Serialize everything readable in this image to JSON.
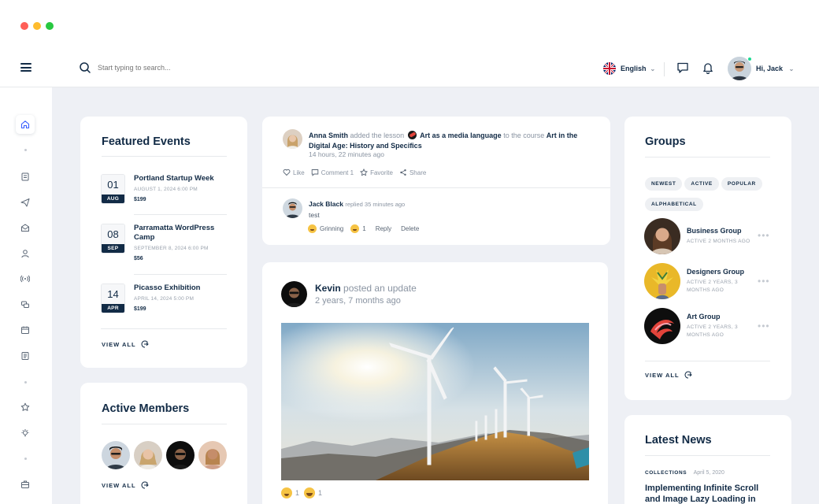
{
  "topbar": {
    "search_placeholder": "Start typing to search...",
    "language": "English",
    "greeting": "Hi,",
    "user_name": "Jack"
  },
  "featured_events": {
    "title": "Featured Events",
    "events": [
      {
        "day": "01",
        "month": "AUG",
        "title": "Portland Startup Week",
        "datetime": "AUGUST 1, 2024 6:00 PM",
        "price": "$199"
      },
      {
        "day": "08",
        "month": "SEP",
        "title": "Parramatta WordPress Camp",
        "datetime": "SEPTEMBER 8, 2024 6:00 PM",
        "price": "$56"
      },
      {
        "day": "14",
        "month": "APR",
        "title": "Picasso Exhibition",
        "datetime": "APRIL 14, 2024 5:00 PM",
        "price": "$199"
      }
    ],
    "view_all": "VIEW ALL"
  },
  "active_members": {
    "title": "Active Members",
    "view_all": "VIEW ALL"
  },
  "activity": {
    "author": "Anna Smith",
    "verb": "added the lesson",
    "lesson": "Art as a media language",
    "connector": "to the course",
    "course": "Art in the Digital Age: History and Specifics",
    "time": "14 hours, 22 minutes ago",
    "actions": {
      "like": "Like",
      "comment": "Comment",
      "comment_count": "1",
      "favorite": "Favorite",
      "share": "Share"
    },
    "reply": {
      "author": "Jack Black",
      "meta": "replied 35 minutes ago",
      "text": "test",
      "reaction_label": "Grinning",
      "reaction_count": "1",
      "reply_label": "Reply",
      "delete_label": "Delete"
    }
  },
  "update": {
    "author": "Kevin",
    "verb": "posted an update",
    "time": "2 years, 7 months ago",
    "reaction_count": "1"
  },
  "groups": {
    "title": "Groups",
    "filters": [
      "NEWEST",
      "ACTIVE",
      "POPULAR",
      "ALPHABETICAL"
    ],
    "items": [
      {
        "name": "Business Group",
        "active": "ACTIVE 2 MONTHS AGO"
      },
      {
        "name": "Designers Group",
        "active": "ACTIVE 2 YEARS, 3 MONTHS AGO"
      },
      {
        "name": "Art Group",
        "active": "ACTIVE 2 YEARS, 3 MONTHS AGO"
      }
    ],
    "view_all": "VIEW ALL"
  },
  "latest_news": {
    "title": "Latest News",
    "category": "COLLECTIONS",
    "date": "April 5, 2020",
    "headline": "Implementing Infinite Scroll and Image Lazy Loading in"
  },
  "colors": {
    "accent": "#385dff",
    "text": "#122b46",
    "muted": "#9aa2ad",
    "background": "#eef0f5"
  }
}
